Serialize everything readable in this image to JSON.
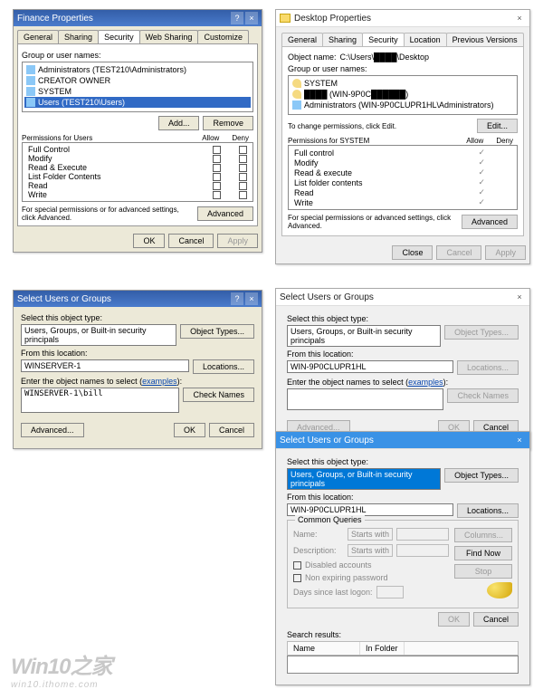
{
  "win7_props": {
    "title": "Finance Properties",
    "tabs": [
      "General",
      "Sharing",
      "Security",
      "Web Sharing",
      "Customize"
    ],
    "active_tab": "Security",
    "group_label": "Group or user names:",
    "users": [
      "Administrators (TEST210\\Administrators)",
      "CREATOR OWNER",
      "SYSTEM",
      "Users (TEST210\\Users)"
    ],
    "selected_user": 3,
    "add_btn": "Add...",
    "remove_btn": "Remove",
    "perms_label": "Permissions for Users",
    "allow": "Allow",
    "deny": "Deny",
    "perms": [
      "Full Control",
      "Modify",
      "Read & Execute",
      "List Folder Contents",
      "Read",
      "Write"
    ],
    "special_note": "For special permissions or for advanced settings, click Advanced.",
    "advanced_btn": "Advanced",
    "ok": "OK",
    "cancel": "Cancel",
    "apply": "Apply"
  },
  "win10_props": {
    "title": "Desktop Properties",
    "tabs": [
      "General",
      "Sharing",
      "Security",
      "Location",
      "Previous Versions"
    ],
    "active_tab": "Security",
    "objname_label": "Object name:",
    "objname": "C:\\Users\\████\\Desktop",
    "group_label": "Group or user names:",
    "users": [
      "SYSTEM",
      "████ (WIN-9P0C██████)",
      "Administrators (WIN-9P0CLUPR1HL\\Administrators)"
    ],
    "change_note": "To change permissions, click Edit.",
    "edit_btn": "Edit...",
    "perms_label": "Permissions for SYSTEM",
    "allow": "Allow",
    "deny": "Deny",
    "perms": [
      "Full control",
      "Modify",
      "Read & execute",
      "List folder contents",
      "Read",
      "Write"
    ],
    "special_note": "For special permissions or advanced settings, click Advanced.",
    "advanced_btn": "Advanced",
    "close": "Close",
    "cancel": "Cancel",
    "apply": "Apply"
  },
  "sel7": {
    "title": "Select Users or Groups",
    "obj_type_lbl": "Select this object type:",
    "obj_type": "Users, Groups, or Built-in security principals",
    "obj_types_btn": "Object Types...",
    "loc_lbl": "From this location:",
    "loc": "WINSERVER-1",
    "locations_btn": "Locations...",
    "names_lbl_pre": "Enter the object names to select (",
    "names_lbl_link": "examples",
    "names_lbl_post": "):",
    "names": "WINSERVER-1\\bill",
    "check_names_btn": "Check Names",
    "advanced_btn": "Advanced...",
    "ok": "OK",
    "cancel": "Cancel"
  },
  "sel10": {
    "title": "Select Users or Groups",
    "obj_type_lbl": "Select this object type:",
    "obj_type": "Users, Groups, or Built-in security principals",
    "obj_types_btn": "Object Types...",
    "loc_lbl": "From this location:",
    "loc": "WIN-9P0CLUPR1HL",
    "locations_btn": "Locations...",
    "names_lbl_pre": "Enter the object names to select (",
    "names_lbl_link": "examples",
    "names_lbl_post": "):",
    "names": "",
    "check_names_btn": "Check Names",
    "advanced_btn": "Advanced...",
    "ok": "OK",
    "cancel": "Cancel"
  },
  "sel_adv": {
    "title": "Select Users or Groups",
    "obj_type_lbl": "Select this object type:",
    "obj_type": "Users, Groups, or Built-in security principals",
    "obj_types_btn": "Object Types...",
    "loc_lbl": "From this location:",
    "loc": "WIN-9P0CLUPR1HL",
    "locations_btn": "Locations...",
    "cq": "Common Queries",
    "name_lbl": "Name:",
    "starts_with": "Starts with",
    "desc_lbl": "Description:",
    "disabled_lbl": "Disabled accounts",
    "nonexp_lbl": "Non expiring password",
    "days_lbl": "Days since last logon:",
    "columns_btn": "Columns...",
    "findnow_btn": "Find Now",
    "stop_btn": "Stop",
    "search_lbl": "Search results:",
    "col_name": "Name",
    "col_folder": "In Folder",
    "ok": "OK",
    "cancel": "Cancel"
  },
  "watermark": {
    "big": "Win10之家",
    "small": "win10.ithome.com"
  }
}
